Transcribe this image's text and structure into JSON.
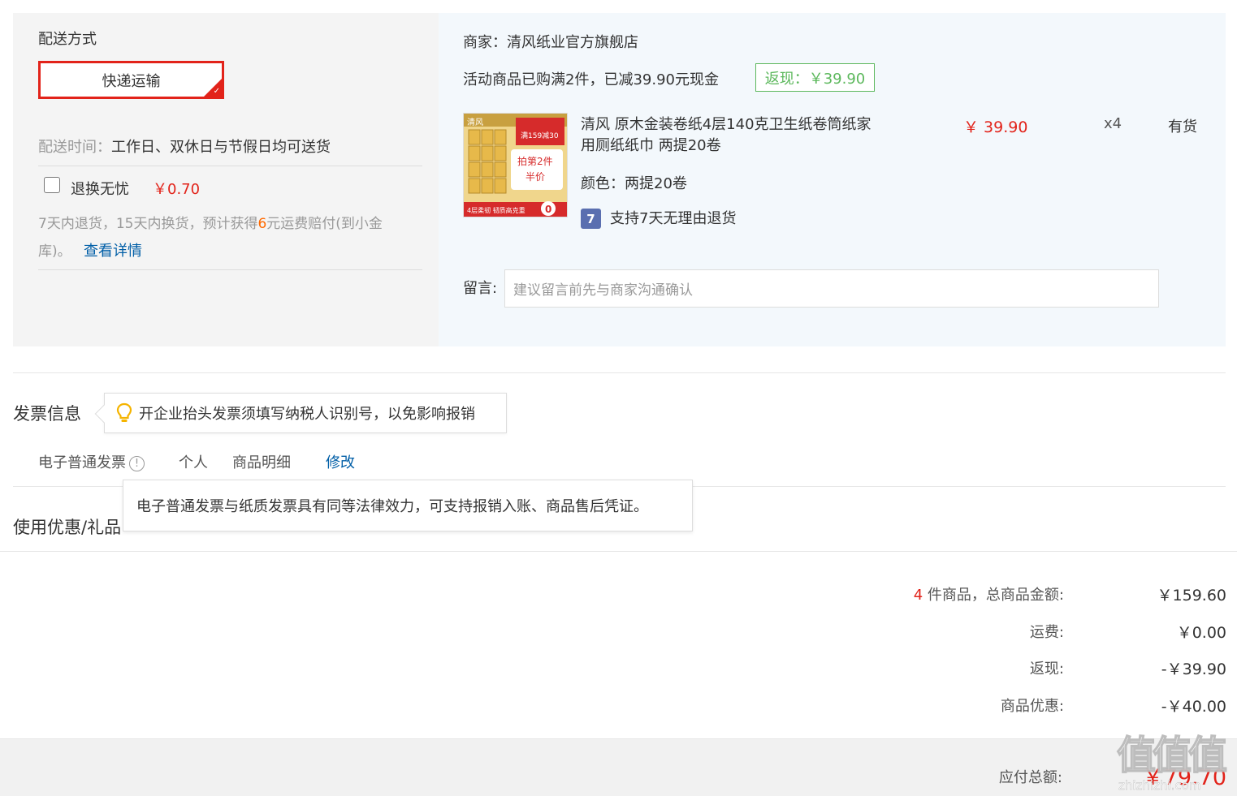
{
  "delivery": {
    "title": "配送方式",
    "method": "快递运输",
    "time_label": "配送时间：",
    "time_value": "工作日、双休日与节假日均可送货",
    "insurance_label": "退换无忧",
    "insurance_price": "￥0.70",
    "insurance_desc_1": "7天内退货，15天内换货，预计获得",
    "insurance_desc_highlight": "6",
    "insurance_desc_2": "元运费赔付(到小金",
    "insurance_desc_3": "库)。",
    "details_link": "查看详情"
  },
  "shop": {
    "merchant": "商家：清风纸业官方旗舰店",
    "promo_text": "活动商品已购满2件，已减39.90元现金",
    "cashback_badge": "返现：￥39.90",
    "product": {
      "title_line1": "清风 原木金装卷纸4层140克卫生纸卷筒纸家",
      "title_line2": "用厕纸纸巾 两提20卷",
      "price": "￥ 39.90",
      "quantity": "x4",
      "stock": "有货",
      "color": "颜色：两提20卷",
      "return_policy": "支持7天无理由退货",
      "return_icon_text": "7",
      "image_texts": {
        "brand": "清风",
        "promo": "满159减30",
        "headline_1": "拍第2件",
        "headline_2": "半价",
        "footer": "4层柔韧 韧质高克重",
        "coupon": "0"
      }
    },
    "note_label": "留言:",
    "note_placeholder": "建议留言前先与商家沟通确认"
  },
  "invoice": {
    "title": "发票信息",
    "tip": "开企业抬头发票须填写纳税人识别号，以免影响报销",
    "type": "电子普通发票",
    "title_type": "个人",
    "content": "商品明细",
    "modify": "修改",
    "info_tooltip": "电子普通发票与纸质发票具有同等法律效力，可支持报销入账、商品售后凭证。"
  },
  "coupons": {
    "title": "使用优惠/礼品"
  },
  "summary": {
    "item_count": "4",
    "items_label": " 件商品，总商品金额:",
    "items_value": "￥159.60",
    "shipping_label": "运费:",
    "shipping_value": "￥0.00",
    "cashback_label": "返现:",
    "cashback_value": "-￥39.90",
    "discount_label": "商品优惠:",
    "discount_value": "-￥40.00",
    "total_label": "应付总额:",
    "total_value": "￥79.70"
  },
  "watermark": {
    "logo": "值",
    "site": "zhizhizhi.com"
  },
  "colors": {
    "accent_red": "#e2231a",
    "link_blue": "#005ea7",
    "cashback_green": "#5cb85c",
    "highlight_orange": "#ff6a00"
  }
}
